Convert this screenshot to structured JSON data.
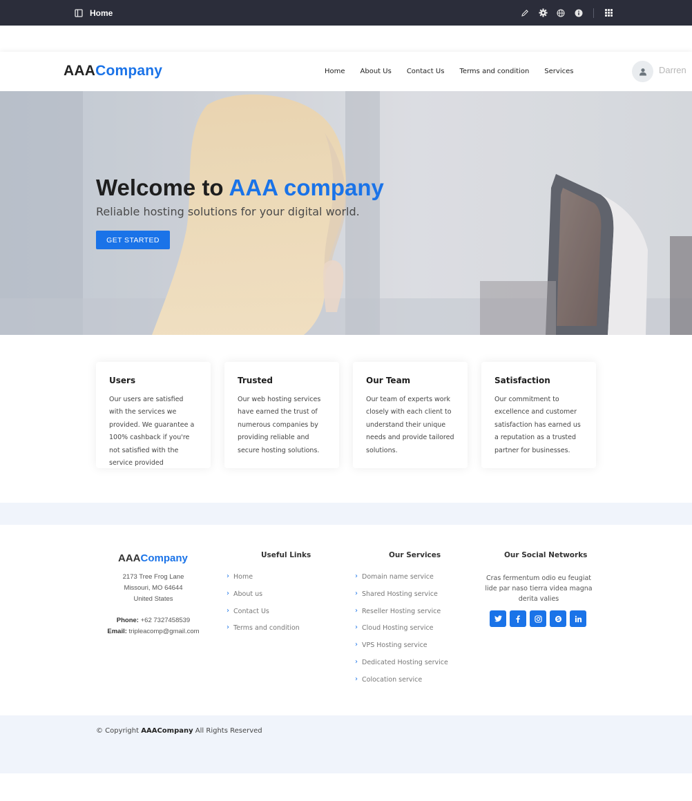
{
  "editor": {
    "title": "Home",
    "icons": [
      "sidebar-toggle-icon",
      "pencil-icon",
      "gear-icon",
      "globe-icon",
      "info-icon",
      "apps-grid-icon"
    ]
  },
  "header": {
    "logo_part1": "AAA",
    "logo_part2": "Company",
    "nav": [
      "Home",
      "About Us",
      "Contact Us",
      "Terms and condition",
      "Services"
    ],
    "user_name": "Darren"
  },
  "hero": {
    "title_part1": "Welcome to ",
    "title_part2": "AAA company",
    "subtitle": "Reliable hosting solutions for your digital world.",
    "button": "GET STARTED"
  },
  "cards": [
    {
      "title": "Users",
      "text": "Our users are satisfied with the services we provided. We guarantee a 100% cashback if you're not satisfied with the service provided"
    },
    {
      "title": "Trusted",
      "text": "Our web hosting services have earned the trust of numerous companies by providing reliable and secure hosting solutions."
    },
    {
      "title": "Our Team",
      "text": "Our team of experts work closely with each client to understand their unique needs and provide tailored solutions."
    },
    {
      "title": "Satisfaction",
      "text": "Our commitment to excellence and customer satisfaction has earned us a reputation as a trusted partner for businesses."
    }
  ],
  "footer": {
    "logo_part1": "AAA",
    "logo_part2": "Company",
    "address": [
      "2173 Tree Frog Lane",
      "Missouri, MO 64644",
      "United States"
    ],
    "phone_label": "Phone:",
    "phone": "+62 7327458539",
    "email_label": "Email:",
    "email": "tripleacomp@gmail.com",
    "useful_links_title": "Useful Links",
    "useful_links": [
      "Home",
      "About us",
      "Contact Us",
      "Terms and condition"
    ],
    "services_title": "Our Services",
    "services": [
      "Domain name service",
      "Shared Hosting service",
      "Reseller Hosting service",
      "Cloud Hosting service",
      "VPS Hosting service",
      "Dedicated Hosting service",
      "Colocation service"
    ],
    "social_title": "Our Social Networks",
    "social_text": "Cras fermentum odio eu feugiat lide par naso tierra videa magna derita valies",
    "social_icons": [
      "twitter-icon",
      "facebook-icon",
      "instagram-icon",
      "skype-icon",
      "linkedin-icon"
    ]
  },
  "copyright": {
    "prefix": "© Copyright ",
    "brand": "AAACompany",
    "suffix": " All Rights Reserved"
  },
  "colors": {
    "accent": "#1a73e8",
    "editor_bar": "#2b2d3a",
    "footer_band": "#f0f4fb"
  }
}
